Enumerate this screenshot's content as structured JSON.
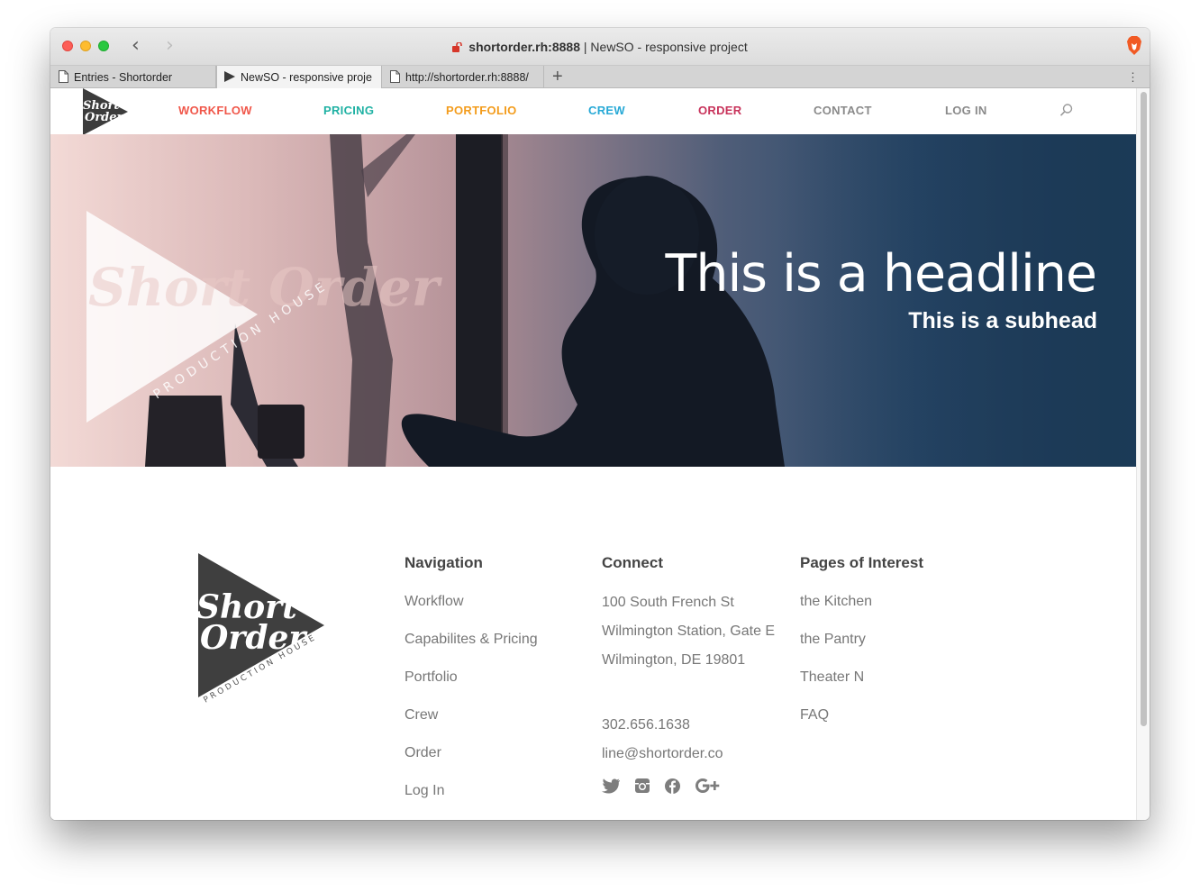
{
  "browser": {
    "host": "shortorder.rh:8888",
    "title_separator": "|",
    "page_title": "NewSO - responsive project",
    "tabs": [
      {
        "label": "Entries - Shortorder"
      },
      {
        "label": "NewSO - responsive proje"
      },
      {
        "label": "http://shortorder.rh:8888/"
      }
    ],
    "new_tab": "+",
    "more": "⋮"
  },
  "site": {
    "logo_text": [
      "Short",
      "Order"
    ],
    "nav": [
      {
        "label": "WORKFLOW",
        "color": "#f0574a"
      },
      {
        "label": "PRICING",
        "color": "#1fb1a3"
      },
      {
        "label": "PORTFOLIO",
        "color": "#f39c1c"
      },
      {
        "label": "CREW",
        "color": "#27a9d6"
      },
      {
        "label": "ORDER",
        "color": "#c8335b"
      },
      {
        "label": "CONTACT",
        "color": "#8a8a8a"
      },
      {
        "label": "LOG IN",
        "color": "#8a8a8a"
      }
    ]
  },
  "hero": {
    "headline": "This is a headline",
    "subhead": "This is a subhead",
    "watermark_text": "Short Order",
    "watermark_sub": "PRODUCTION HOUSE"
  },
  "footer": {
    "logo_words": [
      "Short",
      "Order"
    ],
    "logo_tagline": "PRODUCTION HOUSE",
    "navigation": {
      "heading": "Navigation",
      "links": [
        "Workflow",
        "Capabilites & Pricing",
        "Portfolio",
        "Crew",
        "Order",
        "Log In"
      ]
    },
    "connect": {
      "heading": "Connect",
      "address": [
        "100 South French St",
        "Wilmington Station, Gate E",
        "Wilmington, DE 19801"
      ],
      "phone": "302.656.1638",
      "email": "line@shortorder.co",
      "social": [
        "twitter-icon",
        "instagram-icon",
        "facebook-icon",
        "google-plus-icon"
      ]
    },
    "interest": {
      "heading": "Pages of Interest",
      "links": [
        "the Kitchen",
        "the Pantry",
        "Theater N",
        "FAQ"
      ]
    }
  }
}
